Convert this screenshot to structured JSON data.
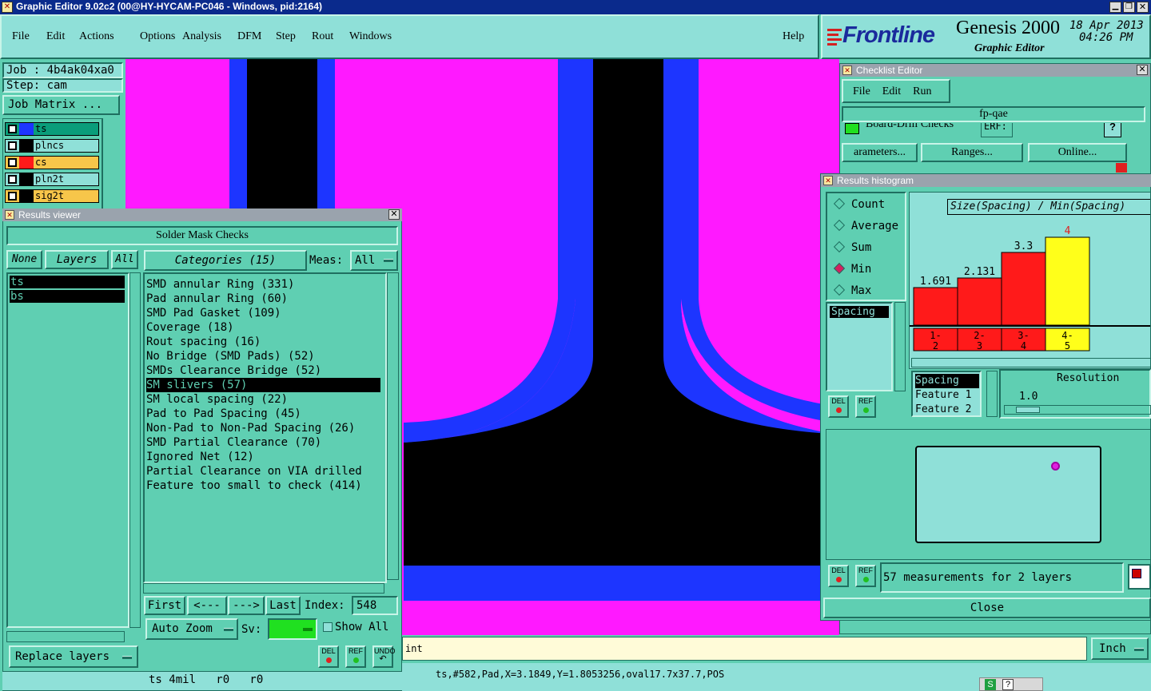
{
  "window": {
    "title": "Graphic Editor 9.02c2 (00@HY-HYCAM-PC046 - Windows, pid:2164)"
  },
  "menu": {
    "items": [
      "File",
      "Edit",
      "Actions",
      "Options",
      "Analysis",
      "DFM",
      "Step",
      "Rout",
      "Windows"
    ],
    "help": "Help"
  },
  "brand": {
    "logo": "Frontline",
    "product": "Genesis 2000",
    "subtitle": "Graphic Editor",
    "date": "18 Apr 2013",
    "time": "04:26 PM"
  },
  "job": {
    "job": "Job : 4b4ak04xa0",
    "step": "Step: cam",
    "matrix_button": "Job Matrix ..."
  },
  "layers": [
    {
      "name": "ts",
      "color": "#1d35ff",
      "bg": "#0a9d7a",
      "text": "#000"
    },
    {
      "name": "plncs",
      "color": "#000000",
      "bg": "#8fe0d8",
      "text": "#000"
    },
    {
      "name": "cs",
      "color": "#ff1a1a",
      "bg": "#f7c64a",
      "text": "#000"
    },
    {
      "name": "pln2t",
      "color": "#000000",
      "bg": "#8fe0d8",
      "text": "#000"
    },
    {
      "name": "sig2t",
      "color": "#000000",
      "bg": "#f7c64a",
      "text": "#000"
    }
  ],
  "results_viewer": {
    "title": "Results viewer",
    "header": "Solder Mask Checks",
    "none": "None",
    "layers": "Layers",
    "all": "All",
    "categories_label": "Categories (15)",
    "meas_label": "Meas:",
    "meas_value": "All",
    "layer_list": [
      "ts",
      "bs"
    ],
    "categories": [
      "SMD annular Ring (331)",
      "Pad annular Ring (60)",
      "SMD Pad Gasket (109)",
      "Coverage (18)",
      "Rout spacing (16)",
      "No Bridge (SMD Pads) (52)",
      "SMDs Clearance Bridge (52)",
      "SM slivers (57)",
      "SM local spacing (22)",
      "Pad to Pad Spacing (45)",
      "Non-Pad to Non-Pad Spacing (26)",
      "SMD Partial Clearance (70)",
      "Ignored Net (12)",
      "Partial Clearance on VIA drilled",
      "Feature too small to check (414)"
    ],
    "selected_category": 7,
    "nav": {
      "first": "First",
      "prev": "<---",
      "next": "--->",
      "last": "Last",
      "index_label": "Index:",
      "index_value": "548"
    },
    "auto_zoom": "Auto Zoom",
    "sv": "Sv:",
    "show_all": "Show All",
    "replace_layers": "Replace layers",
    "del": "DEL",
    "ref": "REF",
    "undo": "UNDO"
  },
  "status": {
    "layer_info": "ts 4mil   r0   r0",
    "command": "int",
    "feature_info": "ts,#582,Pad,X=3.1849,Y=1.8053256,oval17.7x37.7,POS",
    "units": "Inch"
  },
  "checklist": {
    "title": "Checklist Editor",
    "menu": [
      "File",
      "Edit",
      "Run"
    ],
    "name": "fp-qae",
    "row": "Board-Drill Checks",
    "row_tag": "ERF:",
    "buttons": [
      "arameters...",
      "Ranges...",
      "Online..."
    ],
    "date_hint": "18 Apr 2013"
  },
  "histogram": {
    "title": "Results histogram",
    "modes": [
      "Count",
      "Average",
      "Sum",
      "Min",
      "Max"
    ],
    "selected_mode": "Min",
    "measure_list": [
      "Spacing"
    ],
    "chart_title": "Size(Spacing) / Min(Spacing)",
    "fields": [
      "Spacing",
      "Feature 1",
      "Feature 2"
    ],
    "resolution_label": "Resolution",
    "resolution_value": "1.0",
    "measurements": "57 measurements for 2 layers",
    "close": "Close",
    "del": "DEL",
    "ref": "REF"
  },
  "chart_data": {
    "type": "bar",
    "title": "Size(Spacing) / Min(Spacing)",
    "categories": [
      "1-2",
      "2-3",
      "3-4",
      "4-5"
    ],
    "values": [
      1.691,
      2.131,
      3.3,
      4
    ],
    "value_labels": [
      "1.691",
      "2.131",
      "3.3",
      "4"
    ],
    "colors": [
      "#ff1a1a",
      "#ff1a1a",
      "#ff1a1a",
      "#ffff1a"
    ],
    "ylim": [
      0,
      4.5
    ]
  }
}
